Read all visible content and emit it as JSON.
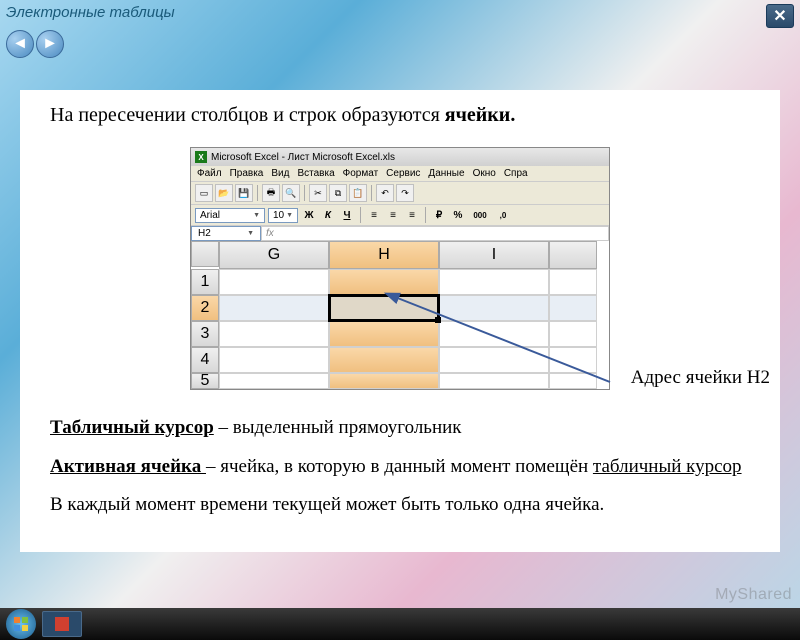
{
  "header": {
    "title": "Электронные таблицы",
    "close": "✕"
  },
  "nav": {
    "back": "◄",
    "forward": "►"
  },
  "intro": {
    "text": "На пересечении столбцов и строк образуются ",
    "bold": "ячейки."
  },
  "excel": {
    "window_title": "Microsoft Excel - Лист Microsoft Excel.xls",
    "menu": [
      "Файл",
      "Правка",
      "Вид",
      "Вставка",
      "Формат",
      "Сервис",
      "Данные",
      "Окно",
      "Спра"
    ],
    "font_name": "Arial",
    "font_size": "10",
    "fmt": {
      "bold": "Ж",
      "italic": "К",
      "underline": "Ч"
    },
    "currency": "%",
    "thousands": "000",
    "dec": ",0",
    "namebox": "H2",
    "fx": "fx",
    "cols": [
      "G",
      "H",
      "I"
    ],
    "rows": [
      "1",
      "2",
      "3",
      "4",
      "5"
    ]
  },
  "annotation": {
    "addr": "Адрес ячейки H2"
  },
  "defs": {
    "d1_u": "Табличный курсор",
    "d1_r": " – выделенный прямоугольник",
    "d2_u": "Активная ячейка ",
    "d2_m": " – ячейка, в которую в данный момент помещён ",
    "d2_u2": "табличный курсор",
    "d3": "В каждый момент времени текущей может быть только одна ячейка."
  },
  "watermark": "MyShared"
}
